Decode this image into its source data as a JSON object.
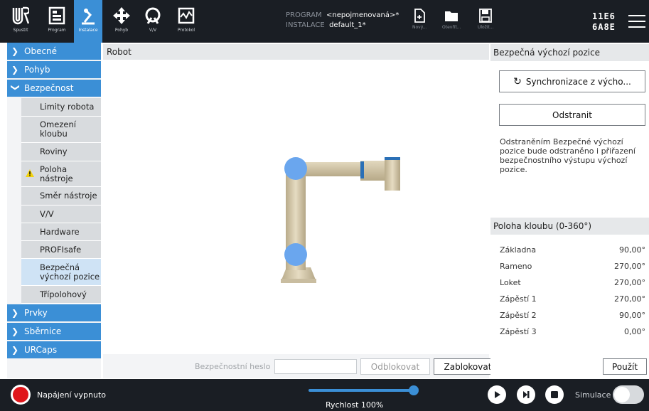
{
  "topbar": {
    "nav": [
      {
        "label": "Spustit",
        "icon": "ur-logo-icon"
      },
      {
        "label": "Program",
        "icon": "program-icon"
      },
      {
        "label": "Instalace",
        "icon": "installation-icon",
        "active": true
      },
      {
        "label": "Pohyb",
        "icon": "move-icon"
      },
      {
        "label": "V/V",
        "icon": "io-icon"
      },
      {
        "label": "Protokol",
        "icon": "log-icon"
      }
    ],
    "program_key": "PROGRAM",
    "program_value": "<nepojmenovaná>*",
    "install_key": "INSTALACE",
    "install_value": "default_1*",
    "file_buttons": [
      {
        "label": "Nový...",
        "icon": "new-file-icon"
      },
      {
        "label": "Otevřít...",
        "icon": "folder-icon"
      },
      {
        "label": "Uložit...",
        "icon": "save-icon"
      }
    ],
    "serial_line1": "11E6",
    "serial_line2": "6A8E"
  },
  "sidebar": {
    "categories": [
      {
        "label": "Obecné"
      },
      {
        "label": "Pohyb"
      },
      {
        "label": "Bezpečnost",
        "expanded": true
      }
    ],
    "safety_items": [
      {
        "label": "Limity robota"
      },
      {
        "label": "Omezení kloubu"
      },
      {
        "label": "Roviny"
      },
      {
        "label": "Poloha nástroje",
        "warning": true
      },
      {
        "label": "Směr nástroje"
      },
      {
        "label": "V/V"
      },
      {
        "label": "Hardware"
      },
      {
        "label": "PROFIsafe"
      },
      {
        "label": "Bezpečná výchozí pozice",
        "selected": true
      },
      {
        "label": "Třípolohový"
      }
    ],
    "categories_after": [
      {
        "label": "Prvky"
      },
      {
        "label": "Sběrnice"
      },
      {
        "label": "URCaps"
      }
    ]
  },
  "main": {
    "header": "Robot",
    "password_label": "Bezpečnostní heslo",
    "password_value": "",
    "unlock_label": "Odblokovat",
    "lock_label": "Zablokovat"
  },
  "right": {
    "header": "Bezpečná výchozí pozice",
    "sync_label": "Synchronizace z výcho...",
    "remove_label": "Odstranit",
    "description": "Odstraněním Bezpečné výchozí pozice bude odstraněno i přiřazení bezpečnostního výstupu výchozí pozice.",
    "joints_header": "Poloha kloubu (0-360°)",
    "joints": [
      {
        "name": "Základna",
        "value": "90,00°"
      },
      {
        "name": "Rameno",
        "value": "270,00°"
      },
      {
        "name": "Loket",
        "value": "270,00°"
      },
      {
        "name": "Zápěstí 1",
        "value": "270,00°"
      },
      {
        "name": "Zápěstí 2",
        "value": "90,00°"
      },
      {
        "name": "Zápěstí 3",
        "value": "0,00°"
      }
    ],
    "apply_label": "Použít"
  },
  "bottom": {
    "power_label": "Napájení vypnuto",
    "speed_label": "Rychlost 100%",
    "speed_fraction": 1.0,
    "simulation_label": "Simulace",
    "simulation_on": false
  },
  "colors": {
    "accent": "#3b8fd6",
    "topbar_bg": "#1a1e24",
    "power_red": "#e0161b",
    "warning": "#f2d20c"
  }
}
